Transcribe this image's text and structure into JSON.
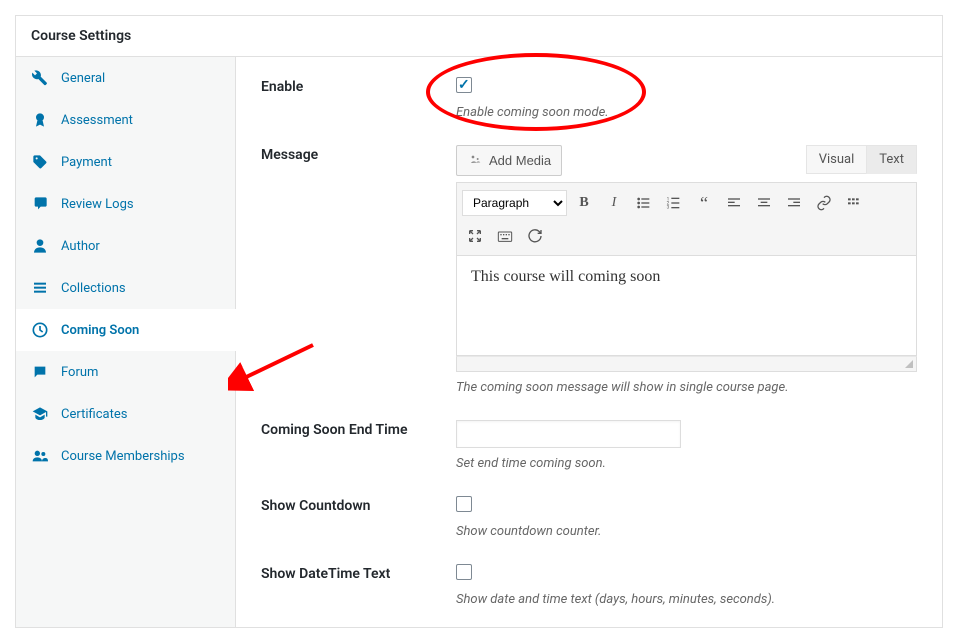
{
  "header": {
    "title": "Course Settings"
  },
  "sidebar": {
    "items": [
      {
        "label": "General",
        "icon": "wrench"
      },
      {
        "label": "Assessment",
        "icon": "award"
      },
      {
        "label": "Payment",
        "icon": "tag"
      },
      {
        "label": "Review Logs",
        "icon": "comments"
      },
      {
        "label": "Author",
        "icon": "user"
      },
      {
        "label": "Collections",
        "icon": "list"
      },
      {
        "label": "Coming Soon",
        "icon": "clock",
        "active": true
      },
      {
        "label": "Forum",
        "icon": "forum"
      },
      {
        "label": "Certificates",
        "icon": "graduation"
      },
      {
        "label": "Course Memberships",
        "icon": "group"
      }
    ]
  },
  "fields": {
    "enable": {
      "label": "Enable",
      "checked": true,
      "hint": "Enable coming soon mode."
    },
    "message": {
      "label": "Message",
      "add_media_label": "Add Media",
      "tabs": {
        "visual": "Visual",
        "text": "Text",
        "active": "text"
      },
      "toolbar": {
        "format_options": [
          "Paragraph"
        ],
        "format_selected": "Paragraph"
      },
      "content": "This course will coming soon",
      "hint": "The coming soon message will show in single course page."
    },
    "end_time": {
      "label": "Coming Soon End Time",
      "value": "",
      "hint": "Set end time coming soon."
    },
    "countdown": {
      "label": "Show Countdown",
      "checked": false,
      "hint": "Show countdown counter."
    },
    "datetime_text": {
      "label": "Show DateTime Text",
      "checked": false,
      "hint": "Show date and time text (days, hours, minutes, seconds)."
    }
  }
}
